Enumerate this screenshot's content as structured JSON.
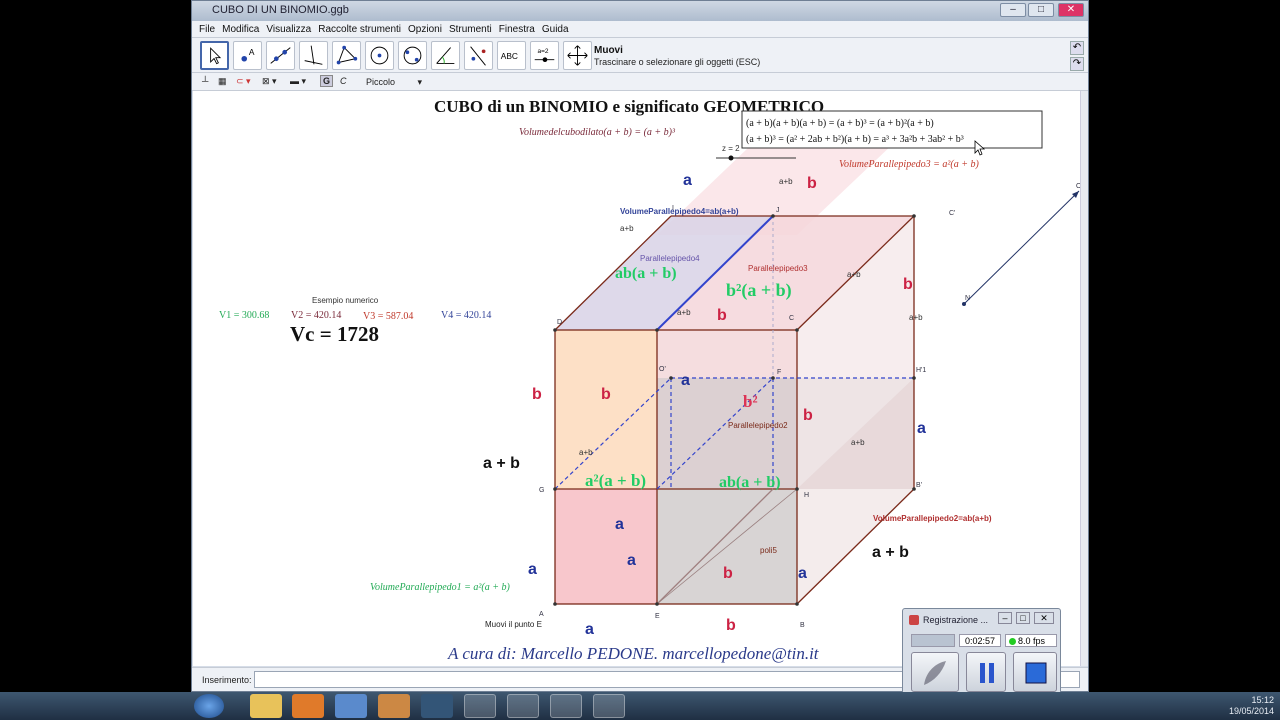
{
  "window": {
    "title": "CUBO DI UN BINOMIO.ggb",
    "controls": [
      "–",
      "□",
      "✕"
    ]
  },
  "menu": [
    "File",
    "Modifica",
    "Visualizza",
    "Raccolte strumenti",
    "Opzioni",
    "Strumenti",
    "Finestra",
    "Guida"
  ],
  "toolbar": {
    "tool_title": "Muovi",
    "tool_help": "Trascinare o selezionare gli oggetti (ESC)",
    "tools": [
      "move-tool-icon",
      "point-tool-icon",
      "line-tool-icon",
      "perpendicular-tool-icon",
      "polygon-tool-icon",
      "circle-tool-icon",
      "circle-3pt-tool-icon",
      "angle-tool-icon",
      "reflect-tool-icon",
      "text-tool-icon",
      "slider-tool-icon",
      "move-view-tool-icon"
    ],
    "text_tool_label": "ABC",
    "slider_tool_label": "a=2"
  },
  "stylebar": {
    "size_label": "Piccolo"
  },
  "canvas": {
    "title": "CUBO di un BINOMIO e significato GEOMETRICO",
    "volume_formula": "Volumedelcubodilato(a + b) = (a + b)³",
    "formula_box_line1": "(a + b)(a + b)(a + b) = (a + b)³ = (a + b)²(a + b)",
    "formula_box_line2": "(a + b)³ = (a² + 2ab + b²)(a + b) = a³ + 3a²b + 3ab² + b³",
    "slider_label": "z = 2",
    "vol_par3": "VolumeParallepipedo3 = a²(a + b)",
    "vol_par4": "VolumeParallepipedo4=ab(a+b)",
    "vol_par2": "VolumeParallepipedo2=ab(a+b)",
    "vol_par1": "VolumeParallepipedo1 = a²(a + b)",
    "esempio": "Esempio numerico",
    "v1": "V1 = 300.68",
    "v2": "V2 = 420.14",
    "v3": "V3 = 587.04",
    "v4": "V4 = 420.14",
    "vc": "Vc = 1728",
    "par4_label": "Parallelepipedo4",
    "par3_label": "Parallelepipedo3",
    "par2_label": "Parallelepipedo2",
    "poli5_label": "poli5",
    "green_ab_top": "ab(a + b)",
    "green_b2": "b²(a + b)",
    "green_a2": "a²(a + b)",
    "green_ab_mid": "ab(a + b)",
    "b2_label": "b²",
    "a": "a",
    "b": "b",
    "apb": "a + b",
    "apb_small": "a+b",
    "points": [
      "A",
      "B",
      "C",
      "D",
      "E",
      "F",
      "G",
      "H",
      "I",
      "J",
      "O'",
      "H'1",
      "B'",
      "C'",
      "O",
      "N"
    ],
    "move_point": "Muovi il punto E",
    "credit": "A cura di: Marcello PEDONE. marcellopedone@tin.it"
  },
  "inputbar": {
    "label": "Inserimento:"
  },
  "recorder": {
    "title": "Registrazione ...",
    "time": "0:02:57",
    "fps": "8.0 fps"
  },
  "taskbar": {
    "time": "15:12",
    "date": "19/05/2014"
  }
}
